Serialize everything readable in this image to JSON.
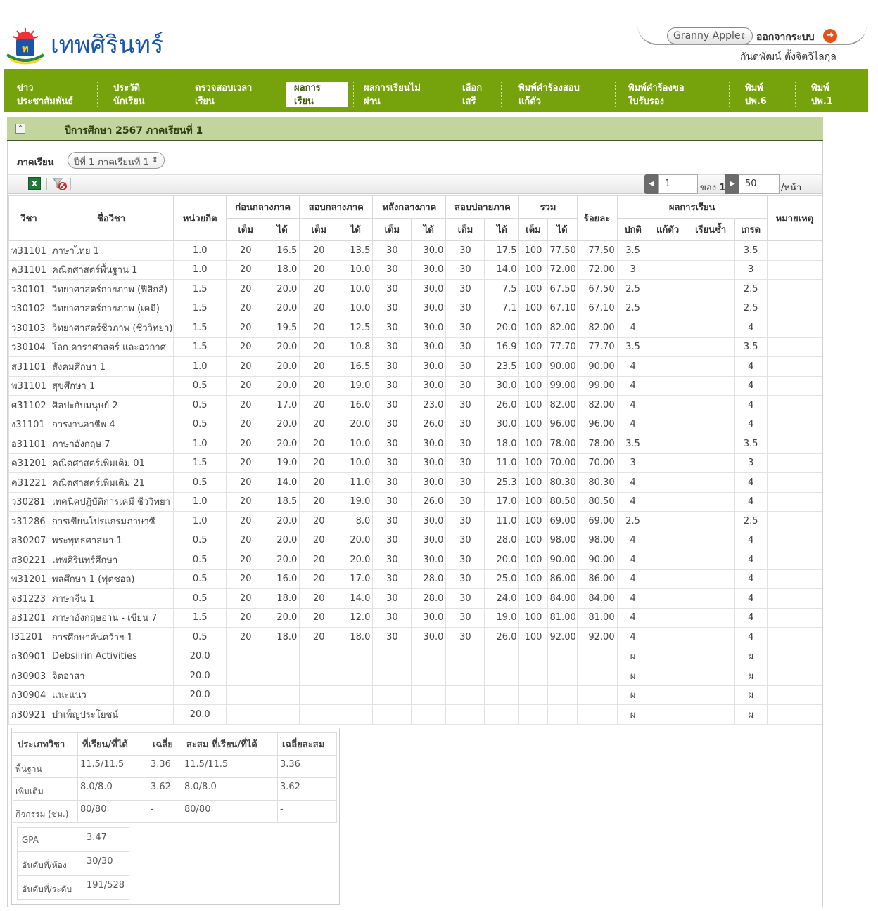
{
  "header": {
    "site_title": "เทพศิรินทร์",
    "user_select_value": "Granny Apple",
    "logout_label": "ออกจากระบบ",
    "user_name": "กันตพัฒน์ ตั้งจิตวิไลกุล"
  },
  "nav": {
    "items": [
      {
        "line1": "ข่าว",
        "line2": "ประชาสัมพันธ์"
      },
      {
        "line1": "ประวัติ",
        "line2": "นักเรียน"
      },
      {
        "line1": "ตรวจสอบเวลา",
        "line2": "เรียน"
      },
      {
        "line1": "ผลการ",
        "line2": "เรียน"
      },
      {
        "line1": "ผลการเรียนไม่",
        "line2": "ผ่าน"
      },
      {
        "line1": "เลือก",
        "line2": "เสรี"
      },
      {
        "line1": "พิมพ์คำร้องสอบ",
        "line2": "แก้ตัว"
      },
      {
        "line1": "พิมพ์คำร้องขอ",
        "line2": "ใบรับรอง"
      },
      {
        "line1": "พิมพ์",
        "line2": "ปพ.6"
      },
      {
        "line1": "พิมพ์",
        "line2": "ปพ.1"
      }
    ]
  },
  "panel": {
    "title": "ปีการศึกษา 2567 ภาคเรียนที่ 1",
    "term_label": "ภาคเรียน",
    "term_select_value": "ปีที่ 1 ภาคเรียนที่ 1"
  },
  "pager": {
    "page": "1",
    "of_label": "ของ",
    "total_pages": "1",
    "page_size": "50",
    "per_page_label": "/หน้า"
  },
  "table": {
    "headers": {
      "subject": "วิชา",
      "name": "ชื่อวิชา",
      "credit": "หน่วยกิต",
      "before_mid": "ก่อนกลางภาค",
      "midterm": "สอบกลางภาค",
      "after_mid": "หลังกลางภาค",
      "final": "สอบปลายภาค",
      "total": "รวม",
      "percent": "ร้อยละ",
      "result": "ผลการเรียน",
      "remark": "หมายเหตุ",
      "full": "เต็ม",
      "got": "ได้",
      "normal": "ปกติ",
      "retest": "แก้ตัว",
      "repeat": "เรียนซ้ำ",
      "grade": "เกรด"
    },
    "rows": [
      [
        "ท31101",
        "ภาษาไทย 1",
        "1.0",
        "20",
        "16.5",
        "20",
        "13.5",
        "30",
        "30.0",
        "30",
        "17.5",
        "100",
        "77.50",
        "77.50",
        "3.5",
        "",
        "",
        "3.5",
        ""
      ],
      [
        "ค31101",
        "คณิตศาสตร์พื้นฐาน 1",
        "1.0",
        "20",
        "18.0",
        "20",
        "10.0",
        "30",
        "30.0",
        "30",
        "14.0",
        "100",
        "72.00",
        "72.00",
        "3",
        "",
        "",
        "3",
        ""
      ],
      [
        "ว30101",
        "วิทยาศาสตร์กายภาพ (ฟิสิกส์)",
        "1.5",
        "20",
        "20.0",
        "20",
        "10.0",
        "30",
        "30.0",
        "30",
        "7.5",
        "100",
        "67.50",
        "67.50",
        "2.5",
        "",
        "",
        "2.5",
        ""
      ],
      [
        "ว30102",
        "วิทยาศาสตร์กายภาพ (เคมี)",
        "1.5",
        "20",
        "20.0",
        "20",
        "10.0",
        "30",
        "30.0",
        "30",
        "7.1",
        "100",
        "67.10",
        "67.10",
        "2.5",
        "",
        "",
        "2.5",
        ""
      ],
      [
        "ว30103",
        "วิทยาศาสตร์ชีวภาพ (ชีววิทยา)",
        "1.5",
        "20",
        "19.5",
        "20",
        "12.5",
        "30",
        "30.0",
        "30",
        "20.0",
        "100",
        "82.00",
        "82.00",
        "4",
        "",
        "",
        "4",
        ""
      ],
      [
        "ว30104",
        "โลก ดาราศาสตร์ และอวกาศ",
        "1.5",
        "20",
        "20.0",
        "20",
        "10.8",
        "30",
        "30.0",
        "30",
        "16.9",
        "100",
        "77.70",
        "77.70",
        "3.5",
        "",
        "",
        "3.5",
        ""
      ],
      [
        "ส31101",
        "สังคมศึกษา 1",
        "1.0",
        "20",
        "20.0",
        "20",
        "16.5",
        "30",
        "30.0",
        "30",
        "23.5",
        "100",
        "90.00",
        "90.00",
        "4",
        "",
        "",
        "4",
        ""
      ],
      [
        "พ31101",
        "สุขศึกษา 1",
        "0.5",
        "20",
        "20.0",
        "20",
        "19.0",
        "30",
        "30.0",
        "30",
        "30.0",
        "100",
        "99.00",
        "99.00",
        "4",
        "",
        "",
        "4",
        ""
      ],
      [
        "ศ31102",
        "ศิลปะกับมนุษย์ 2",
        "0.5",
        "20",
        "17.0",
        "20",
        "16.0",
        "30",
        "23.0",
        "30",
        "26.0",
        "100",
        "82.00",
        "82.00",
        "4",
        "",
        "",
        "4",
        ""
      ],
      [
        "ง31101",
        "การงานอาชีพ 4",
        "0.5",
        "20",
        "20.0",
        "20",
        "20.0",
        "30",
        "26.0",
        "30",
        "30.0",
        "100",
        "96.00",
        "96.00",
        "4",
        "",
        "",
        "4",
        ""
      ],
      [
        "อ31101",
        "ภาษาอังกฤษ 7",
        "1.0",
        "20",
        "20.0",
        "20",
        "10.0",
        "30",
        "30.0",
        "30",
        "18.0",
        "100",
        "78.00",
        "78.00",
        "3.5",
        "",
        "",
        "3.5",
        ""
      ],
      [
        "ค31201",
        "คณิตศาสตร์เพิ่มเติม 01",
        "1.5",
        "20",
        "19.0",
        "20",
        "10.0",
        "30",
        "30.0",
        "30",
        "11.0",
        "100",
        "70.00",
        "70.00",
        "3",
        "",
        "",
        "3",
        ""
      ],
      [
        "ค31221",
        "คณิตศาสตร์เพิ่มเติม 21",
        "0.5",
        "20",
        "14.0",
        "20",
        "11.0",
        "30",
        "30.0",
        "30",
        "25.3",
        "100",
        "80.30",
        "80.30",
        "4",
        "",
        "",
        "4",
        ""
      ],
      [
        "ว30281",
        "เทคนิคปฏิบัติการเคมี ชีววิทยา",
        "1.0",
        "20",
        "18.5",
        "20",
        "19.0",
        "30",
        "26.0",
        "30",
        "17.0",
        "100",
        "80.50",
        "80.50",
        "4",
        "",
        "",
        "4",
        ""
      ],
      [
        "ว31286",
        "การเขียนโปรแกรมภาษาซี",
        "1.0",
        "20",
        "20.0",
        "20",
        "8.0",
        "30",
        "30.0",
        "30",
        "11.0",
        "100",
        "69.00",
        "69.00",
        "2.5",
        "",
        "",
        "2.5",
        ""
      ],
      [
        "ส30207",
        "พระพุทธศาสนา 1",
        "0.5",
        "20",
        "20.0",
        "20",
        "20.0",
        "30",
        "30.0",
        "30",
        "28.0",
        "100",
        "98.00",
        "98.00",
        "4",
        "",
        "",
        "4",
        ""
      ],
      [
        "ส30221",
        "เทพศิรินทร์ศึกษา",
        "0.5",
        "20",
        "20.0",
        "20",
        "20.0",
        "30",
        "30.0",
        "30",
        "20.0",
        "100",
        "90.00",
        "90.00",
        "4",
        "",
        "",
        "4",
        ""
      ],
      [
        "พ31201",
        "พลศึกษา 1 (ฟุตซอล)",
        "0.5",
        "20",
        "16.0",
        "20",
        "17.0",
        "30",
        "28.0",
        "30",
        "25.0",
        "100",
        "86.00",
        "86.00",
        "4",
        "",
        "",
        "4",
        ""
      ],
      [
        "จ31223",
        "ภาษาจีน 1",
        "0.5",
        "20",
        "18.0",
        "20",
        "14.0",
        "30",
        "28.0",
        "30",
        "24.0",
        "100",
        "84.00",
        "84.00",
        "4",
        "",
        "",
        "4",
        ""
      ],
      [
        "อ31201",
        "ภาษาอังกฤษอ่าน - เขียน 7",
        "1.5",
        "20",
        "20.0",
        "20",
        "12.0",
        "30",
        "30.0",
        "30",
        "19.0",
        "100",
        "81.00",
        "81.00",
        "4",
        "",
        "",
        "4",
        ""
      ],
      [
        "I31201",
        "การศึกษาค้นคว้าฯ 1",
        "0.5",
        "20",
        "18.0",
        "20",
        "18.0",
        "30",
        "30.0",
        "30",
        "26.0",
        "100",
        "92.00",
        "92.00",
        "4",
        "",
        "",
        "4",
        ""
      ],
      [
        "ก30901",
        "Debsiirin Activities",
        "20.0",
        "",
        "",
        "",
        "",
        "",
        "",
        "",
        "",
        "",
        "",
        "",
        "ผ",
        "",
        "",
        "ผ",
        ""
      ],
      [
        "ก30903",
        "จิตอาสา",
        "20.0",
        "",
        "",
        "",
        "",
        "",
        "",
        "",
        "",
        "",
        "",
        "",
        "ผ",
        "",
        "",
        "ผ",
        ""
      ],
      [
        "ก30904",
        "แนะแนว",
        "20.0",
        "",
        "",
        "",
        "",
        "",
        "",
        "",
        "",
        "",
        "",
        "",
        "ผ",
        "",
        "",
        "ผ",
        ""
      ],
      [
        "ก30921",
        "บำเพ็ญประโยชน์",
        "20.0",
        "",
        "",
        "",
        "",
        "",
        "",
        "",
        "",
        "",
        "",
        "",
        "ผ",
        "",
        "",
        "ผ",
        ""
      ]
    ]
  },
  "summary": {
    "headers": [
      "ประเภทวิชา",
      "ที่เรียน/ที่ได้",
      "เฉลี่ย",
      "สะสม ที่เรียน/ที่ได้",
      "เฉลี่ยสะสม"
    ],
    "rows": [
      [
        "พื้นฐาน",
        "11.5/11.5",
        "3.36",
        "11.5/11.5",
        "3.36"
      ],
      [
        "เพิ่มเติม",
        "8.0/8.0",
        "3.62",
        "8.0/8.0",
        "3.62"
      ],
      [
        "กิจกรรม (ชม.)",
        "80/80",
        "-",
        "80/80",
        "-"
      ]
    ],
    "gpa_label": "GPA",
    "gpa": "3.47",
    "rank_class_label": "อันดับที่/ห้อง",
    "rank_class": "30/30",
    "rank_level_label": "อันดับที่/ระดับ",
    "rank_level": "191/528"
  }
}
